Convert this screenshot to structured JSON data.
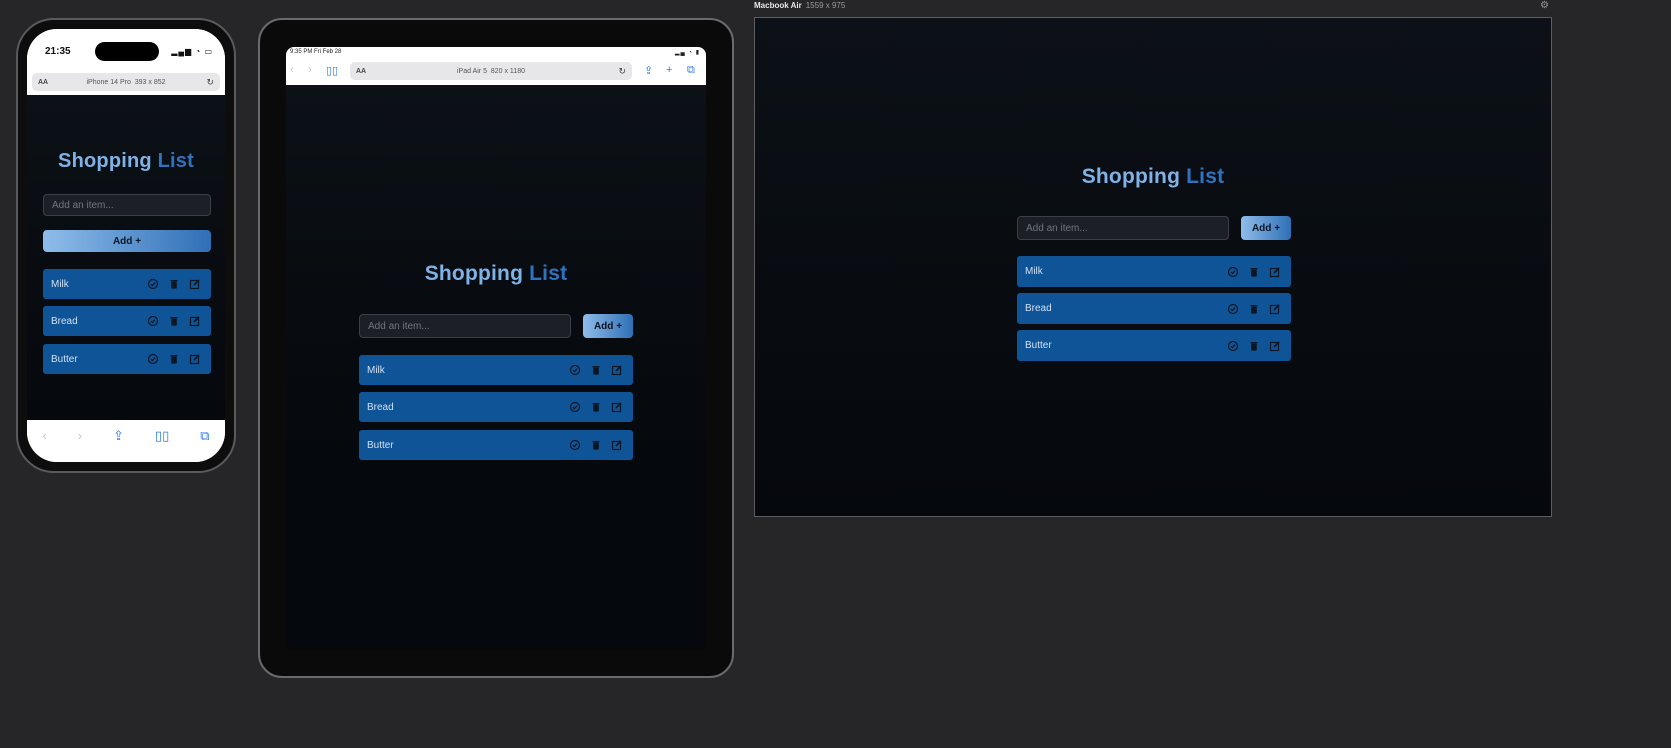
{
  "app": {
    "title_word1": "Shopping",
    "title_word2": "List",
    "input_placeholder": "Add an item...",
    "add_label": "Add",
    "add_icon": "+",
    "items": [
      {
        "label": "Milk"
      },
      {
        "label": "Bread"
      },
      {
        "label": "Butter"
      }
    ],
    "colors": {
      "background": "#05080c",
      "item": "#0f5496",
      "title_light": "#7fb2e6",
      "title_dark": "#2e73c0",
      "accent_gradient_start": "#8fbdea",
      "accent_gradient_end": "#2f6fb6"
    }
  },
  "phone": {
    "time": "21:35",
    "url_label": "iPhone 14 Pro",
    "url_size": "393 x 852",
    "aa": "AA"
  },
  "tablet": {
    "status_time": "9:35 PM Fri Feb 28",
    "url_label": "iPad Air 5",
    "url_size": "820 x 1180",
    "aa": "AA"
  },
  "laptop": {
    "name": "Macbook Air",
    "size": "1559 x 975"
  },
  "icons": {
    "item_actions": [
      "check-circle-icon",
      "trash-icon",
      "edit-icon"
    ],
    "phone_bottom": [
      "back-icon",
      "forward-icon",
      "share-icon",
      "bookmarks-icon",
      "tabs-icon"
    ],
    "settings": "gear-icon"
  }
}
